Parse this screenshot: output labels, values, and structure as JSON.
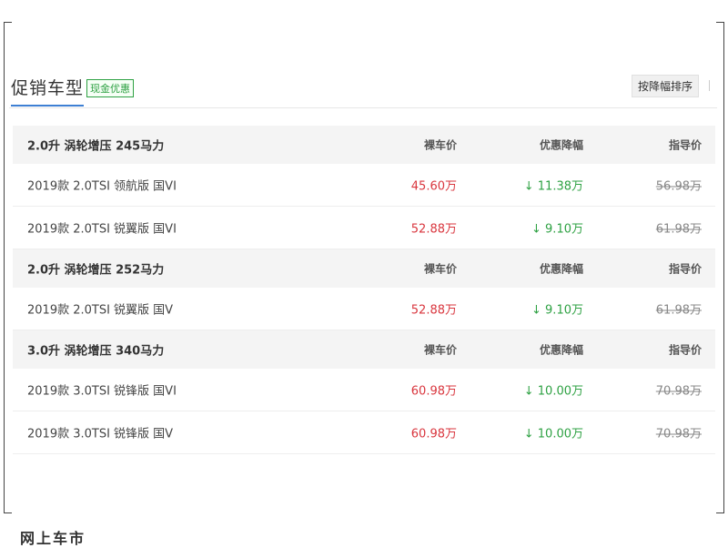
{
  "header": {
    "title": "促销车型",
    "badge": "现金优惠",
    "sort_button": "按降幅排序"
  },
  "groups": [
    {
      "engine": "2.0升 涡轮增压 245马力",
      "col_price": "裸车价",
      "col_discount": "优惠降幅",
      "col_guide": "指导价",
      "models": [
        {
          "name": "2019款 2.0TSI 领航版 国VI",
          "price": "45.60万",
          "discount": "↓ 11.38万",
          "guide": "56.98万"
        },
        {
          "name": "2019款 2.0TSI 锐翼版 国VI",
          "price": "52.88万",
          "discount": "↓ 9.10万",
          "guide": "61.98万"
        }
      ]
    },
    {
      "engine": "2.0升 涡轮增压 252马力",
      "col_price": "裸车价",
      "col_discount": "优惠降幅",
      "col_guide": "指导价",
      "models": [
        {
          "name": "2019款 2.0TSI 锐翼版 国V",
          "price": "52.88万",
          "discount": "↓ 9.10万",
          "guide": "61.98万"
        }
      ]
    },
    {
      "engine": "3.0升 涡轮增压 340马力",
      "col_price": "裸车价",
      "col_discount": "优惠降幅",
      "col_guide": "指导价",
      "models": [
        {
          "name": "2019款 3.0TSI 锐锋版 国VI",
          "price": "60.98万",
          "discount": "↓ 10.00万",
          "guide": "70.98万"
        },
        {
          "name": "2019款 3.0TSI 锐锋版 国V",
          "price": "60.98万",
          "discount": "↓ 10.00万",
          "guide": "70.98万"
        }
      ]
    }
  ],
  "watermark": "网上车市",
  "colors": {
    "accent": "#3d7fd3",
    "price": "#d9363e",
    "discount": "#2ea143",
    "group_bg": "#f4f4f4"
  }
}
